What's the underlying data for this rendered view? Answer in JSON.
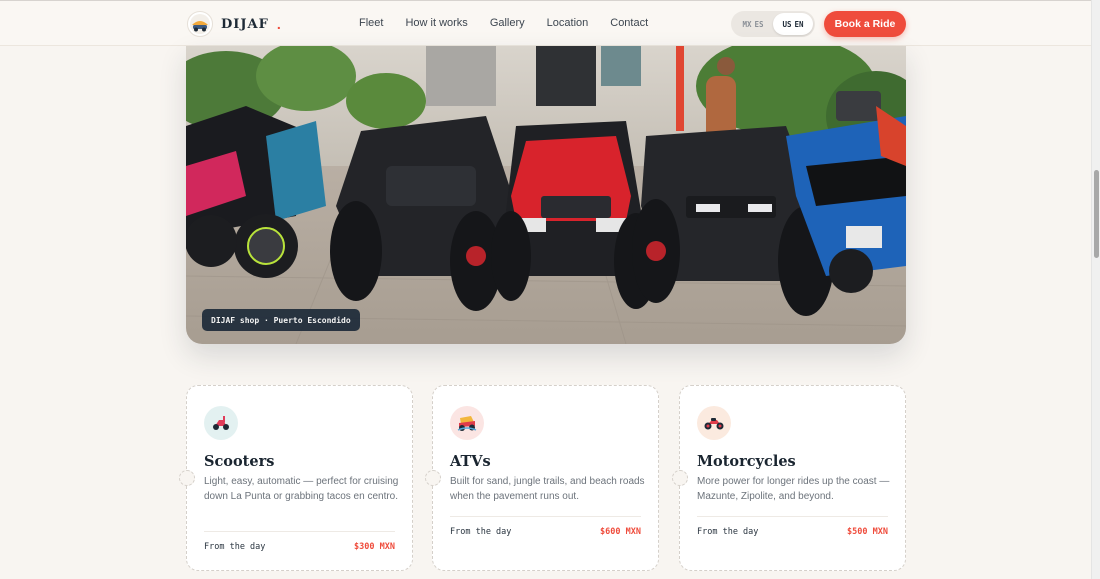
{
  "header": {
    "brand_name": "DIJAF",
    "brand_dot": ".",
    "nav": [
      "Fleet",
      "How it works",
      "Gallery",
      "Location",
      "Contact"
    ],
    "lang": {
      "es": {
        "flag": "MX",
        "code": "ES"
      },
      "en": {
        "flag": "US",
        "code": "EN"
      },
      "active": "en"
    },
    "book_label": "Book a Ride"
  },
  "hero": {
    "caption": "DIJAF shop · Puerto Escondido"
  },
  "cards": [
    {
      "title": "Scooters",
      "icon": "scooter-icon",
      "description": "Light, easy, automatic — perfect for cruising down La Punta or grabbing tacos en centro.",
      "price_label": "From the day",
      "price": "$300 MXN"
    },
    {
      "title": "ATVs",
      "icon": "atv-icon",
      "description": "Built for sand, jungle trails, and beach roads when the pavement runs out.",
      "price_label": "From the day",
      "price": "$600 MXN"
    },
    {
      "title": "Motorcycles",
      "icon": "motorcycle-icon",
      "description": "More power for longer rides up the coast — Mazunte, Zipolite, and beyond.",
      "price_label": "From the day",
      "price": "$500 MXN"
    }
  ],
  "colors": {
    "accent": "#ef4c3c",
    "background": "#f8f5f1",
    "dark": "#1e2a36"
  }
}
